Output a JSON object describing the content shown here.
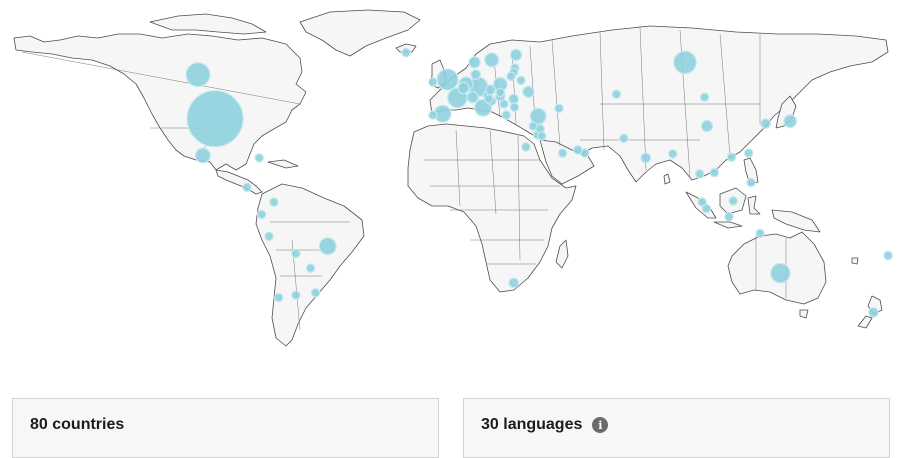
{
  "stats": {
    "countries_label": "80 countries",
    "languages_label": "30 languages",
    "info_icon": "info-icon"
  },
  "map": {
    "land_color": "#f6f6f7",
    "border_color": "#4d4d4d",
    "bubble_color": "#8fd1dd"
  },
  "map_points": [
    {
      "name": "United States",
      "lon": -97,
      "lat": 38,
      "value": 100
    },
    {
      "name": "Canada",
      "lon": -104,
      "lat": 56,
      "value": 18
    },
    {
      "name": "Mexico",
      "lon": -102,
      "lat": 23,
      "value": 7
    },
    {
      "name": "Cuba",
      "lon": -79,
      "lat": 22,
      "value": 1
    },
    {
      "name": "Costa Rica",
      "lon": -84,
      "lat": 10,
      "value": 1
    },
    {
      "name": "Colombia",
      "lon": -73,
      "lat": 4,
      "value": 2
    },
    {
      "name": "Ecuador",
      "lon": -78,
      "lat": -1,
      "value": 1.5
    },
    {
      "name": "Peru",
      "lon": -75,
      "lat": -10,
      "value": 1.5
    },
    {
      "name": "Brazil",
      "lon": -51,
      "lat": -14,
      "value": 9
    },
    {
      "name": "Bolivia",
      "lon": -64,
      "lat": -17,
      "value": 1
    },
    {
      "name": "Paraguay",
      "lon": -58,
      "lat": -23,
      "value": 1
    },
    {
      "name": "Uruguay",
      "lon": -56,
      "lat": -33,
      "value": 1
    },
    {
      "name": "Argentina",
      "lon": -64,
      "lat": -34,
      "value": 2
    },
    {
      "name": "Chile",
      "lon": -71,
      "lat": -35,
      "value": 2
    },
    {
      "name": "Iceland",
      "lon": -19,
      "lat": 65,
      "value": 1
    },
    {
      "name": "Ireland",
      "lon": -8,
      "lat": 53,
      "value": 2
    },
    {
      "name": "United Kingdom",
      "lon": -2,
      "lat": 54,
      "value": 14
    },
    {
      "name": "Portugal",
      "lon": -8,
      "lat": 39.5,
      "value": 2
    },
    {
      "name": "Spain",
      "lon": -4,
      "lat": 40,
      "value": 9
    },
    {
      "name": "France",
      "lon": 2,
      "lat": 46.5,
      "value": 12
    },
    {
      "name": "Belgium",
      "lon": 4.5,
      "lat": 50.5,
      "value": 4
    },
    {
      "name": "Netherlands",
      "lon": 5.5,
      "lat": 52.2,
      "value": 6
    },
    {
      "name": "Germany",
      "lon": 10.5,
      "lat": 51,
      "value": 12
    },
    {
      "name": "Switzerland",
      "lon": 8.2,
      "lat": 46.8,
      "value": 4
    },
    {
      "name": "Italy",
      "lon": 12.5,
      "lat": 42.5,
      "value": 9
    },
    {
      "name": "Austria",
      "lon": 14.5,
      "lat": 47.5,
      "value": 3
    },
    {
      "name": "Denmark",
      "lon": 9.5,
      "lat": 56,
      "value": 3
    },
    {
      "name": "Norway",
      "lon": 9,
      "lat": 61,
      "value": 4
    },
    {
      "name": "Sweden",
      "lon": 16,
      "lat": 62,
      "value": 6
    },
    {
      "name": "Finland",
      "lon": 26,
      "lat": 64,
      "value": 4
    },
    {
      "name": "Estonia",
      "lon": 25.5,
      "lat": 58.7,
      "value": 1.5
    },
    {
      "name": "Latvia",
      "lon": 25,
      "lat": 56.9,
      "value": 1.5
    },
    {
      "name": "Lithuania",
      "lon": 23.9,
      "lat": 55.3,
      "value": 1.5
    },
    {
      "name": "Poland",
      "lon": 19.5,
      "lat": 52,
      "value": 6
    },
    {
      "name": "Czechia",
      "lon": 15.5,
      "lat": 49.8,
      "value": 3
    },
    {
      "name": "Slovakia",
      "lon": 19.5,
      "lat": 48.7,
      "value": 2
    },
    {
      "name": "Hungary",
      "lon": 19.5,
      "lat": 47.2,
      "value": 3
    },
    {
      "name": "Slovenia",
      "lon": 14.8,
      "lat": 46.1,
      "value": 1
    },
    {
      "name": "Croatia",
      "lon": 16,
      "lat": 45.2,
      "value": 2
    },
    {
      "name": "Serbia",
      "lon": 21,
      "lat": 44,
      "value": 2
    },
    {
      "name": "Romania",
      "lon": 25,
      "lat": 46,
      "value": 3
    },
    {
      "name": "Bulgaria",
      "lon": 25.3,
      "lat": 42.7,
      "value": 2
    },
    {
      "name": "Greece",
      "lon": 22,
      "lat": 39.5,
      "value": 2
    },
    {
      "name": "Ukraine",
      "lon": 31,
      "lat": 49,
      "value": 4
    },
    {
      "name": "Belarus",
      "lon": 28,
      "lat": 53.7,
      "value": 2
    },
    {
      "name": "Turkey",
      "lon": 35,
      "lat": 39,
      "value": 8
    },
    {
      "name": "Cyprus",
      "lon": 33,
      "lat": 35,
      "value": 1
    },
    {
      "name": "Lebanon",
      "lon": 35.8,
      "lat": 33.9,
      "value": 1
    },
    {
      "name": "Israel",
      "lon": 34.8,
      "lat": 31.4,
      "value": 2
    },
    {
      "name": "Jordan",
      "lon": 36.5,
      "lat": 31,
      "value": 1
    },
    {
      "name": "Egypt",
      "lon": 30,
      "lat": 26.5,
      "value": 1
    },
    {
      "name": "Saudi Arabia",
      "lon": 45,
      "lat": 24,
      "value": 1
    },
    {
      "name": "Qatar",
      "lon": 51.2,
      "lat": 25.3,
      "value": 1
    },
    {
      "name": "United Arab Emirates",
      "lon": 54,
      "lat": 24,
      "value": 1.5
    },
    {
      "name": "Georgia",
      "lon": 43.5,
      "lat": 42.2,
      "value": 1
    },
    {
      "name": "Russia",
      "lon": 95,
      "lat": 61,
      "value": 16
    },
    {
      "name": "Kazakhstan",
      "lon": 67,
      "lat": 48,
      "value": 2
    },
    {
      "name": "Pakistan",
      "lon": 70,
      "lat": 30,
      "value": 1
    },
    {
      "name": "India",
      "lon": 79,
      "lat": 22,
      "value": 3
    },
    {
      "name": "Bangladesh",
      "lon": 90,
      "lat": 23.7,
      "value": 1
    },
    {
      "name": "Mongolia",
      "lon": 103,
      "lat": 46.8,
      "value": 1
    },
    {
      "name": "China",
      "lon": 104,
      "lat": 35,
      "value": 4
    },
    {
      "name": "South Korea",
      "lon": 128,
      "lat": 36,
      "value": 3
    },
    {
      "name": "Japan",
      "lon": 138,
      "lat": 37,
      "value": 5
    },
    {
      "name": "Taiwan",
      "lon": 121,
      "lat": 24,
      "value": 2
    },
    {
      "name": "Hong Kong",
      "lon": 114,
      "lat": 22.3,
      "value": 2
    },
    {
      "name": "Thailand",
      "lon": 101,
      "lat": 15.5,
      "value": 2
    },
    {
      "name": "Vietnam",
      "lon": 107,
      "lat": 16,
      "value": 1.5
    },
    {
      "name": "Philippines",
      "lon": 122,
      "lat": 12,
      "value": 2
    },
    {
      "name": "Malaysia",
      "lon": 102,
      "lat": 4,
      "value": 1.5
    },
    {
      "name": "Singapore",
      "lon": 103.8,
      "lat": 1.3,
      "value": 2
    },
    {
      "name": "Indonesia",
      "lon": 113,
      "lat": -2,
      "value": 1.5
    },
    {
      "name": "East Timor",
      "lon": 125.7,
      "lat": -8.8,
      "value": 1
    },
    {
      "name": "Brunei",
      "lon": 114.7,
      "lat": 4.5,
      "value": 1
    },
    {
      "name": "South Africa",
      "lon": 25,
      "lat": -29,
      "value": 3
    },
    {
      "name": "Australia",
      "lon": 134,
      "lat": -25,
      "value": 12
    },
    {
      "name": "New Zealand",
      "lon": 172,
      "lat": -41,
      "value": 3
    },
    {
      "name": "Fiji",
      "lon": 178,
      "lat": -17.8,
      "value": 1
    }
  ]
}
